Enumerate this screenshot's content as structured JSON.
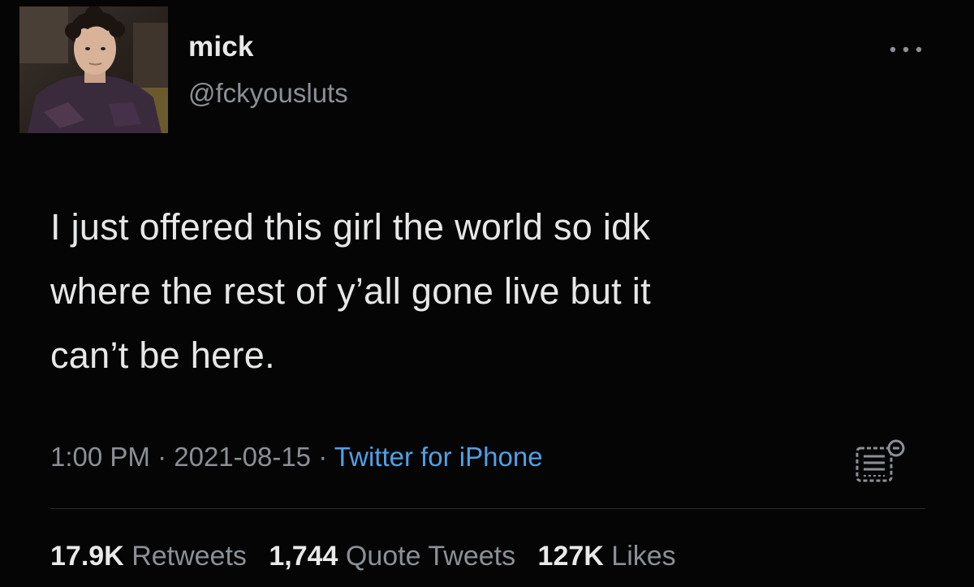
{
  "user": {
    "name": "mick",
    "handle": "@fckyousluts"
  },
  "tweet": {
    "lines": [
      "I just offered this girl the world so idk",
      "where the rest of y’all gone live but it",
      "can’t be here."
    ],
    "time": "1:00 PM",
    "separator": " · ",
    "date": "2021-08-15",
    "source": "Twitter for iPhone"
  },
  "stats": {
    "retweets_count": "17.9K",
    "retweets_label": "Retweets",
    "quotes_count": "1,744",
    "quotes_label": "Quote Tweets",
    "likes_count": "127K",
    "likes_label": "Likes"
  },
  "icons": {
    "more": "more-horizontal-icon",
    "analytics": "analytics-icon"
  },
  "colors": {
    "background": "#050505",
    "text": "#e6e7e8",
    "muted": "#8b9096",
    "link": "#4ea1e8"
  }
}
